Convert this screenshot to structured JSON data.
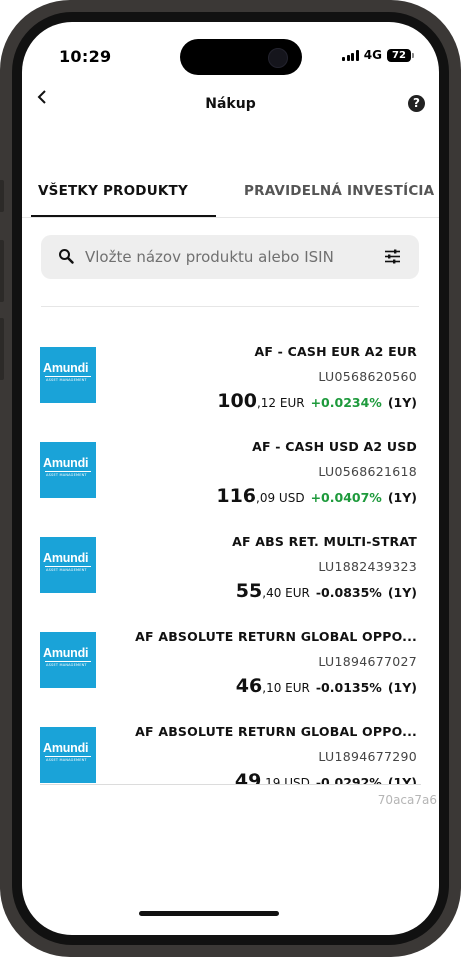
{
  "status_bar": {
    "time": "10:29",
    "network": "4G",
    "battery": "72"
  },
  "header": {
    "title": "Nákup",
    "back_icon": "chevron-left-icon",
    "help_icon": "question-icon",
    "help_glyph": "?"
  },
  "tabs": [
    {
      "label": "VŠETKY PRODUKTY",
      "active": true
    },
    {
      "label": "PRAVIDELNÁ INVESTÍCIA",
      "active": false
    }
  ],
  "search": {
    "placeholder": "Vložte názov produktu alebo ISIN",
    "value": ""
  },
  "products": [
    {
      "logo_text": "Amundi",
      "logo_sub": "ASSET MANAGEMENT",
      "name": "AF - CASH EUR A2 EUR",
      "isin": "LU0568620560",
      "price_int": "100",
      "price_dec": ",12 EUR",
      "change": "+0.0234%",
      "change_dir": "pos",
      "period": "(1Y)"
    },
    {
      "logo_text": "Amundi",
      "logo_sub": "ASSET MANAGEMENT",
      "name": "AF - CASH USD A2 USD",
      "isin": "LU0568621618",
      "price_int": "116",
      "price_dec": ",09 USD",
      "change": "+0.0407%",
      "change_dir": "pos",
      "period": "(1Y)"
    },
    {
      "logo_text": "Amundi",
      "logo_sub": "ASSET MANAGEMENT",
      "name": "AF ABS RET. MULTI-STRAT",
      "isin": "LU1882439323",
      "price_int": "55",
      "price_dec": ",40 EUR",
      "change": "-0.0835%",
      "change_dir": "neg",
      "period": "(1Y)"
    },
    {
      "logo_text": "Amundi",
      "logo_sub": "ASSET MANAGEMENT",
      "name": "AF ABSOLUTE RETURN GLOBAL OPPO...",
      "isin": "LU1894677027",
      "price_int": "46",
      "price_dec": ",10 EUR",
      "change": "-0.0135%",
      "change_dir": "neg",
      "period": "(1Y)"
    },
    {
      "logo_text": "Amundi",
      "logo_sub": "ASSET MANAGEMENT",
      "name": "AF ABSOLUTE RETURN GLOBAL OPPO...",
      "isin": "LU1894677290",
      "price_int": "49",
      "price_dec": ",19 USD",
      "change": "-0.0292%",
      "change_dir": "neg",
      "period": "(1Y)"
    }
  ],
  "footer": {
    "hash": "70aca7a6"
  },
  "colors": {
    "positive": "#1e9a3c",
    "brand": "#1aa3d8"
  }
}
